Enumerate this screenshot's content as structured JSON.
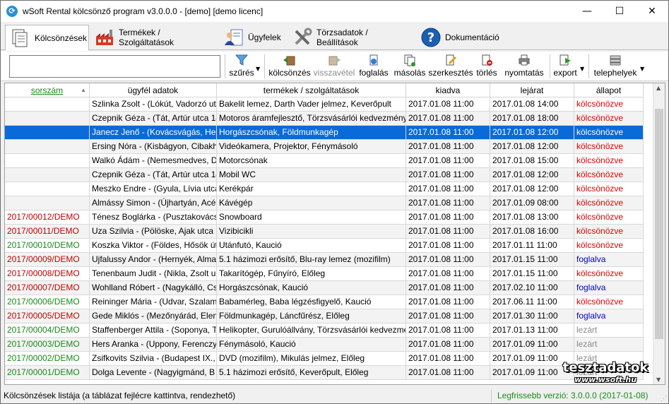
{
  "window": {
    "title": "wSoft Rental kölcsönző program v3.0.0.0 - [demo] [demo licenc]",
    "minimize": "—",
    "maximize": "☐",
    "close": "✕"
  },
  "tabs": [
    {
      "label": "Kölcsönzések",
      "icon": "documents-icon"
    },
    {
      "label": "Termékek / Szolgáltatások",
      "icon": "factory-icon"
    },
    {
      "label": "Ügyfelek",
      "icon": "person-card-icon"
    },
    {
      "label": "Törzsadatok / Beállítások",
      "icon": "tools-icon"
    },
    {
      "label": "Dokumentáció",
      "icon": "help-icon"
    }
  ],
  "toolbar": {
    "search_value": "",
    "filter": "szűrés",
    "rentals": "kölcsönzés",
    "return": "visszavétel",
    "booking": "foglalás",
    "copy": "másolás",
    "edit": "szerkesztés",
    "delete": "törlés",
    "print": "nyomtatás",
    "export": "export",
    "locations": "telephelyek"
  },
  "table": {
    "headers": [
      "sorszám",
      "ügyfél adatok",
      "termékek / szolgáltatások",
      "kiadva",
      "lejárat",
      "állapot"
    ],
    "rows": [
      {
        "id": "",
        "client": "Szlinka Zsolt - (Lókút, Vadorzó ut",
        "items": "Bakelit lemez, Darth Vader jelmez, Keverőpult",
        "out": "2017.01.08  11:00",
        "due": "2017.01.08  14:00",
        "status": "kölcsönözve"
      },
      {
        "id": "",
        "client": "Czepnik Géza - (Tát, Artúr utca 14",
        "items": "Motoros áramfejlesztő, Törzsvásárlói kedvezmény",
        "out": "2017.01.08  11:00",
        "due": "2017.01.08  18:00",
        "status": "kölcsönözve"
      },
      {
        "id": "",
        "client": "Janecz Jenő - (Kovácsvágás, Hegy",
        "items": "Horgászcsónak, Földmunkagép",
        "out": "2017.01.08  11:00",
        "due": "2017.01.08  12:00",
        "status": "kölcsönözve"
      },
      {
        "id": "",
        "client": "Ersing Nóra - (Kisbágyon, Cibakh",
        "items": "Videókamera, Projektor, Fénymásoló",
        "out": "2017.01.08  11:00",
        "due": "2017.01.08  12:00",
        "status": "kölcsönözve"
      },
      {
        "id": "",
        "client": "Walkó Ádám - (Nemesmedves, D",
        "items": "Motorcsónak",
        "out": "2017.01.08  11:00",
        "due": "2017.01.08  15:00",
        "status": "kölcsönözve"
      },
      {
        "id": "",
        "client": "Czepnik Géza - (Tát, Artúr utca 14",
        "items": "Mobil WC",
        "out": "2017.01.08  11:00",
        "due": "2017.01.08  12:00",
        "status": "kölcsönözve"
      },
      {
        "id": "",
        "client": "Meszko Endre - (Gyula, Lívia utca",
        "items": "Kerékpár",
        "out": "2017.01.08  11:00",
        "due": "2017.01.08  12:00",
        "status": "kölcsönözve"
      },
      {
        "id": "",
        "client": "Almássy Simon - (Újhartyán, Acé",
        "items": "Kávégép",
        "out": "2017.01.08  11:00",
        "due": "2017.01.09  08:00",
        "status": "kölcsönözve"
      },
      {
        "id": "2017/00012/DEMO",
        "client": "Ténesz Boglárka - (Pusztakovácsi,",
        "items": "Snowboard",
        "out": "2017.01.08  11:00",
        "due": "2017.01.08  13:00",
        "status": "kölcsönözve"
      },
      {
        "id": "2017/00011/DEMO",
        "client": "Uza Szilvia - (Pölöske, Ajak utca 1",
        "items": "Vizibicikli",
        "out": "2017.01.08  11:00",
        "due": "2017.01.08  16:00",
        "status": "kölcsönözve"
      },
      {
        "id": "2017/00010/DEMO",
        "client": "Koszka Viktor - (Földes, Hősök út",
        "items": "Utánfutó, Kaució",
        "out": "2017.01.08  11:00",
        "due": "2017.01.11  11:00",
        "status": "kölcsönözve"
      },
      {
        "id": "2017/00009/DEMO",
        "client": "Ujfalussy Andor - (Hernyék, Alma",
        "items": "5.1 házimozi erősítő, Blu-ray lemez (mozifilm)",
        "out": "2017.01.08  11:00",
        "due": "2017.01.15  11:00",
        "status": "foglalva"
      },
      {
        "id": "2017/00008/DEMO",
        "client": "Tenenbaum Judit - (Nikla, Zsolt u",
        "items": "Takarítógép, Fűnyíró, Előleg",
        "out": "2017.01.08  11:00",
        "due": "2017.01.15  11:00",
        "status": "kölcsönözve"
      },
      {
        "id": "2017/00007/DEMO",
        "client": "Wohlland Róbert - (Nagykálló, Cs",
        "items": "Horgászcsónak, Kaució",
        "out": "2017.01.08  11:00",
        "due": "2017.02.10  11:00",
        "status": "foglalva"
      },
      {
        "id": "2017/00006/DEMO",
        "client": "Reininger Mária - (Udvar, Szalam",
        "items": "Babamérleg, Baba légzésfigyelő, Kaució",
        "out": "2017.01.08  11:00",
        "due": "2017.06.11  11:00",
        "status": "kölcsönözve"
      },
      {
        "id": "2017/00005/DEMO",
        "client": "Gede Miklós - (Mezőnyárád, Elen",
        "items": "Földmunkagép, Láncfűrész, Előleg",
        "out": "2017.01.08  11:00",
        "due": "2017.01.30  11:00",
        "status": "foglalva"
      },
      {
        "id": "2017/00004/DEMO",
        "client": "Staffenberger Attila - (Soponya, T",
        "items": "Helikopter, Gurulóállvány, Törzsvásárlói kedvezmé",
        "out": "2017.01.08  11:00",
        "due": "2017.01.13  11:00",
        "status": "lezárt"
      },
      {
        "id": "2017/00003/DEMO",
        "client": "Hers Aranka - (Uppony, Ferenczy",
        "items": "Fénymásoló, Kaució",
        "out": "2017.01.08  11:00",
        "due": "2017.01.09  11:00",
        "status": "lezárt"
      },
      {
        "id": "2017/00002/DEMO",
        "client": "Zsifkovits Szilvia - (Budapest IX., I",
        "items": "DVD (mozifilm), Mikulás jelmez, Előleg",
        "out": "2017.01.08  11:00",
        "due": "2017.01.09  11:00",
        "status": "lezárt"
      },
      {
        "id": "2017/00001/DEMO",
        "client": "Dolga Levente - (Nagyigmánd, B",
        "items": "5.1 házimozi erősítő, Keverőpult, Előleg",
        "out": "2017.01.08  11:00",
        "due": "2017.01.09  11:00",
        "status": "lezárt"
      }
    ]
  },
  "status": {
    "left": "Kölcsönzések listája (a táblázat fejlécre kattintva, rendezhető)",
    "right": "Legfrissebb verzió: 3.0.0.0 (2017-01-08)"
  },
  "watermark": {
    "brand": "tesztadatok",
    "site": "www.wsoft.hu"
  },
  "colors": {
    "selected_row": "#0a6ad8",
    "status_rented": "#e00000",
    "status_booked": "#0000d0",
    "status_closed": "#8a8a8a",
    "id_red": "#c00000",
    "id_green": "#1a8a1a",
    "version_green": "#1a8a1a",
    "sort_header": "#1a8a1a"
  }
}
